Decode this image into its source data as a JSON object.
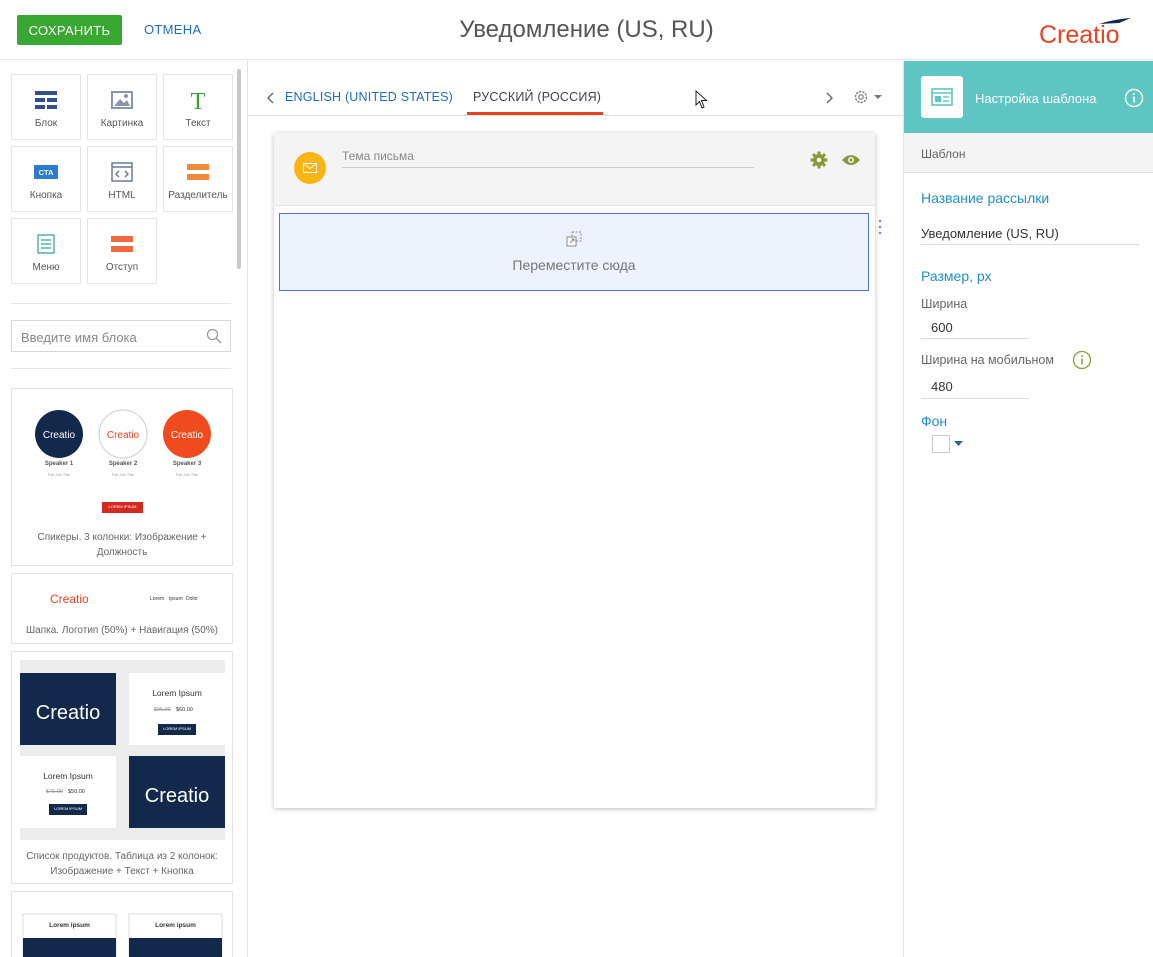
{
  "header": {
    "save_label": "СОХРАНИТЬ",
    "cancel_label": "ОТМЕНА",
    "title": "Уведомление (US, RU)",
    "logo_text": "Creatio"
  },
  "tools": [
    {
      "label": "Блок",
      "icon": "grid-icon"
    },
    {
      "label": "Картинка",
      "icon": "image-icon"
    },
    {
      "label": "Текст",
      "icon": "text-icon"
    },
    {
      "label": "Кнопка",
      "icon": "cta-icon"
    },
    {
      "label": "HTML",
      "icon": "html-icon"
    },
    {
      "label": "Разделитель",
      "icon": "divider-icon"
    },
    {
      "label": "Меню",
      "icon": "menu-icon"
    },
    {
      "label": "Отступ",
      "icon": "spacer-icon"
    }
  ],
  "search": {
    "placeholder": "Введите имя блока"
  },
  "templates": [
    {
      "caption_line1": "Спикеры. 3 колонки: Изображение +",
      "caption_line2": "Должность",
      "speakers": [
        "Speaker 1",
        "Speaker 2",
        "Speaker 3"
      ],
      "speaker_sub": "Full Job Title",
      "button": "LOREM IPSUM"
    },
    {
      "caption_line1": "Шапка. Логотип (50%) + Навигация (50%)",
      "nav": [
        "Lorem",
        "Ipsum",
        "Dolor"
      ]
    },
    {
      "caption_line1": "Список продуктов. Таблица из 2 колонок:",
      "caption_line2": "Изображение + Текст + Кнопка",
      "product_title": "Lorem Ipsum",
      "old_price_1": "$95.00",
      "price_1": "$60.00",
      "old_price_2": "$75.00",
      "price_2": "$50.00",
      "button": "LOREM IPSUM"
    },
    {
      "product_title": "Lorem ipsum"
    }
  ],
  "languages": {
    "tab_en": "ENGLISH (UNITED STATES)",
    "tab_ru": "РУССКИЙ (РОССИЯ)"
  },
  "email": {
    "subject_placeholder": "Тема письма",
    "drop_text": "Переместите сюда"
  },
  "settings": {
    "header_title": "Настройка шаблона",
    "subheader": "Шаблон",
    "mailing_name_label": "Название рассылки",
    "mailing_name_value": "Уведомление (US, RU)",
    "size_label": "Размер, px",
    "width_label": "Ширина",
    "width_value": "600",
    "mobile_width_label": "Ширина на мобильном",
    "mobile_width_value": "480",
    "background_label": "Фон"
  },
  "colors": {
    "save_green": "#38a832",
    "link_blue": "#1f6fb5",
    "accent_orange": "#e8431f",
    "teal": "#5ec5c3",
    "navy": "#13294b"
  }
}
